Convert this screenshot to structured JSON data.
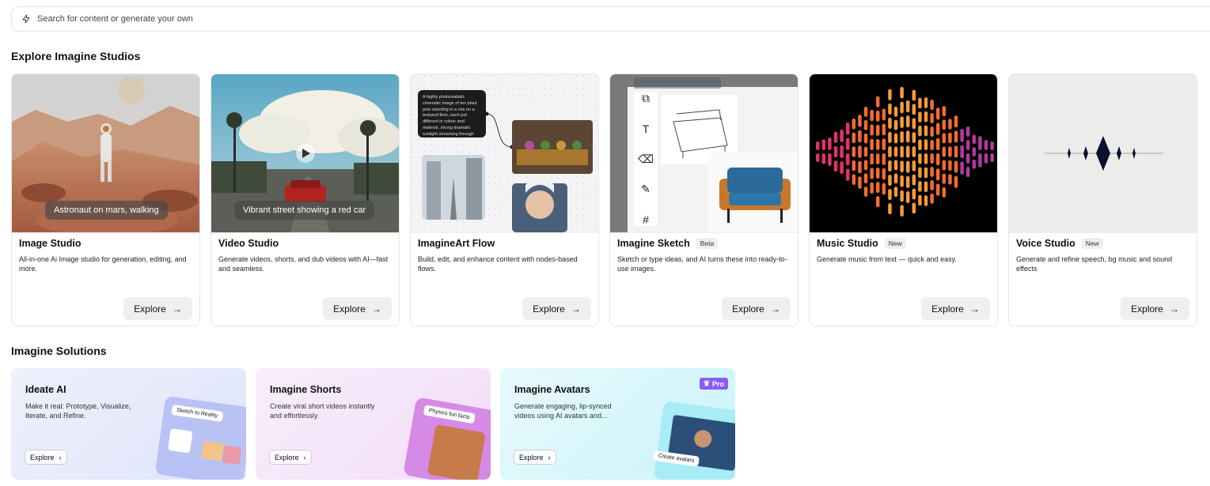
{
  "search": {
    "placeholder": "Search for content or generate your own"
  },
  "sections": {
    "studios_title": "Explore Imagine Studios",
    "solutions_title": "Imagine Solutions"
  },
  "studios": [
    {
      "title": "Image Studio",
      "badge": "",
      "desc": "All-in-one Ai Image studio for generation, editing, and more.",
      "caption": "Astronaut on mars, walking",
      "button": "Explore"
    },
    {
      "title": "Video Studio",
      "badge": "",
      "desc": "Generate videos, shorts, and dub videos with AI—fast and seamless.",
      "caption": "Vibrant street showing a red car",
      "button": "Explore"
    },
    {
      "title": "ImagineArt Flow",
      "badge": "",
      "desc": "Build, edit, and enhance content with nodes-based flows.",
      "prompt": "A highly photorealistic cinematic image of ten plant pots standing in a row on a textured floor, each pot different in colour and material, strong dramatic sunlight streaming through",
      "button": "Explore"
    },
    {
      "title": "Imagine Sketch",
      "badge": "Beta",
      "desc": "Sketch or type ideas, and AI turns these into ready-to-use images.",
      "button": "Explore"
    },
    {
      "title": "Music Studio",
      "badge": "New",
      "desc": "Generate music from text — quick and easy.",
      "button": "Explore"
    },
    {
      "title": "Voice Studio",
      "badge": "New",
      "desc": "Generate and refine speech, bg music and sound effects",
      "button": "Explore"
    }
  ],
  "solutions": [
    {
      "title": "Ideate AI",
      "desc": "Make it real: Prototype, Visualize, Iterate, and Refine.",
      "button": "Explore",
      "tag": "Sketch to Reality",
      "pro": ""
    },
    {
      "title": "Imagine Shorts",
      "desc": "Create viral short videos instantly and effortlessly.",
      "button": "Explore",
      "tag": "Physics fun facts",
      "pro": ""
    },
    {
      "title": "Imagine Avatars",
      "desc": "Generate engaging, lip-synced videos using AI avatars and...",
      "button": "Explore",
      "tag": "Create avatars",
      "pro": "Pro"
    }
  ],
  "colors": {
    "accent": "#8b5cf6",
    "music_bars": [
      "#e0336b",
      "#f36b2f",
      "#f59a3a",
      "#b13aa0"
    ]
  },
  "icons": {
    "search": "lightning-icon",
    "arrow": "arrow-right-icon",
    "chevron": "chevron-right-icon",
    "play": "play-icon",
    "crown": "crown-icon"
  }
}
